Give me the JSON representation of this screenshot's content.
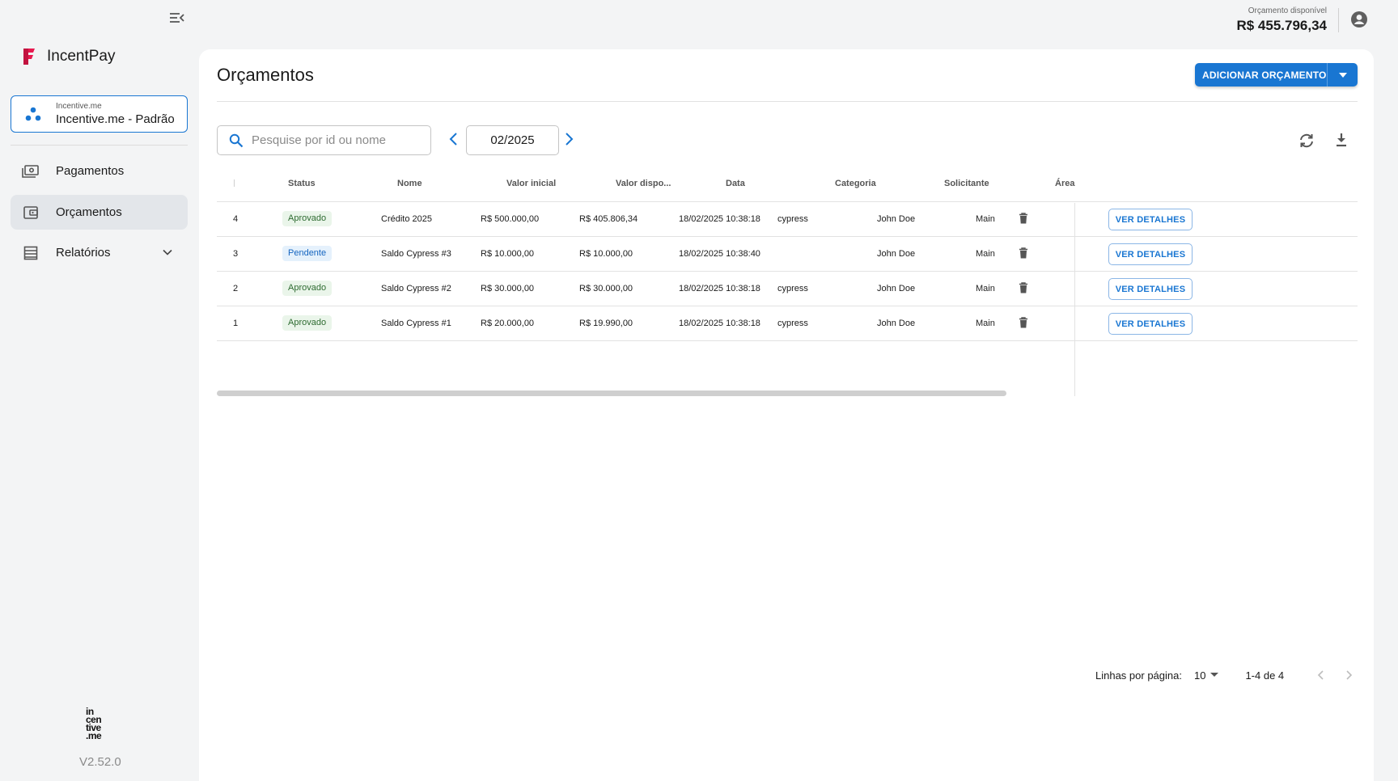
{
  "app": {
    "name": "IncentPay",
    "version": "V2.52.0",
    "footer_logo": "in cen tive .me"
  },
  "org": {
    "small_label": "Incentive.me",
    "name": "Incentive.me - Padrão"
  },
  "sidebar": {
    "items": [
      {
        "label": "Pagamentos",
        "icon": "payments-icon",
        "active": false
      },
      {
        "label": "Orçamentos",
        "icon": "wallet-icon",
        "active": true
      },
      {
        "label": "Relatórios",
        "icon": "reports-icon",
        "active": false,
        "expandable": true
      }
    ]
  },
  "header": {
    "budget_label": "Orçamento disponível",
    "budget_value": "R$ 455.796,34"
  },
  "page": {
    "title": "Orçamentos",
    "add_button": "ADICIONAR ORÇAMENTO"
  },
  "filters": {
    "search_placeholder": "Pesquise por id ou nome",
    "month": "02/2025"
  },
  "table": {
    "columns": [
      "Status",
      "Nome",
      "Valor inicial",
      "Valor dispo...",
      "Data",
      "Categoria",
      "Solicitante",
      "Área"
    ],
    "rows": [
      {
        "id": "4",
        "status": "Aprovado",
        "status_kind": "aprovado",
        "nome": "Crédito 2025",
        "valor_inicial": "R$ 500.000,00",
        "valor_disponivel": "R$ 405.806,34",
        "data": "18/02/2025 10:38:18",
        "categoria": "cypress",
        "solicitante": "John Doe",
        "area": "Main",
        "action": "VER DETALHES"
      },
      {
        "id": "3",
        "status": "Pendente",
        "status_kind": "pendente",
        "nome": "Saldo Cypress #3",
        "valor_inicial": "R$ 10.000,00",
        "valor_disponivel": "R$ 10.000,00",
        "data": "18/02/2025 10:38:40",
        "categoria": "",
        "solicitante": "John Doe",
        "area": "Main",
        "action": "VER DETALHES"
      },
      {
        "id": "2",
        "status": "Aprovado",
        "status_kind": "aprovado",
        "nome": "Saldo Cypress #2",
        "valor_inicial": "R$ 30.000,00",
        "valor_disponivel": "R$ 30.000,00",
        "data": "18/02/2025 10:38:18",
        "categoria": "cypress",
        "solicitante": "John Doe",
        "area": "Main",
        "action": "VER DETALHES"
      },
      {
        "id": "1",
        "status": "Aprovado",
        "status_kind": "aprovado",
        "nome": "Saldo Cypress #1",
        "valor_inicial": "R$ 20.000,00",
        "valor_disponivel": "R$ 19.990,00",
        "data": "18/02/2025 10:38:18",
        "categoria": "cypress",
        "solicitante": "John Doe",
        "area": "Main",
        "action": "VER DETALHES"
      }
    ]
  },
  "pagination": {
    "rows_label": "Linhas por página:",
    "rows_per_page": "10",
    "range": "1-4 de 4"
  },
  "colors": {
    "primary": "#1976d2",
    "brand": "#e8194f",
    "approved_bg": "#eaf5ea",
    "pending_bg": "#e5f1fc"
  }
}
